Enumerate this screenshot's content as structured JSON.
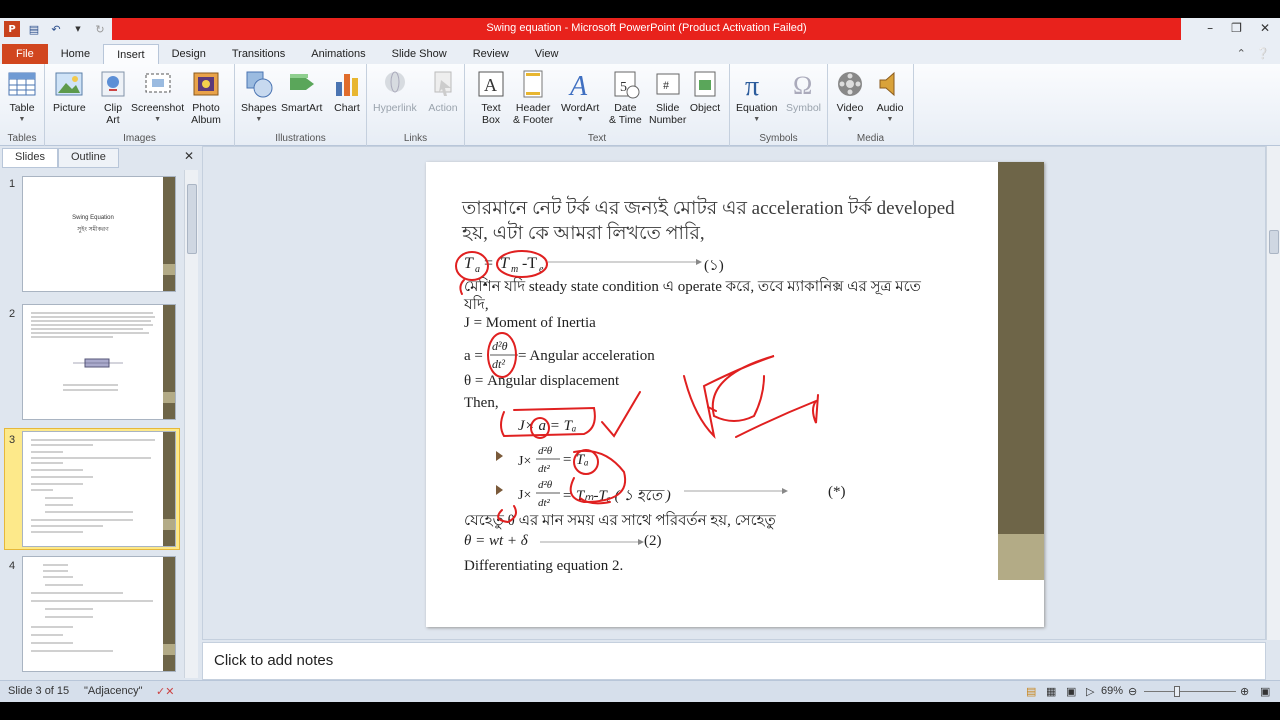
{
  "window": {
    "title": "Swing equation  -  Microsoft PowerPoint (Product Activation Failed)"
  },
  "ribbon_tabs": [
    "File",
    "Home",
    "Insert",
    "Design",
    "Transitions",
    "Animations",
    "Slide Show",
    "Review",
    "View"
  ],
  "active_tab": "Insert",
  "ribbon": {
    "tables": {
      "label": "Tables",
      "table": "Table"
    },
    "images": {
      "label": "Images",
      "picture": "Picture",
      "clipart": "Clip\nArt",
      "screenshot": "Screenshot",
      "photoalbum": "Photo\nAlbum"
    },
    "illustrations": {
      "label": "Illustrations",
      "shapes": "Shapes",
      "smartart": "SmartArt",
      "chart": "Chart"
    },
    "links": {
      "label": "Links",
      "hyperlink": "Hyperlink",
      "action": "Action"
    },
    "text": {
      "label": "Text",
      "textbox": "Text\nBox",
      "headerfooter": "Header\n& Footer",
      "wordart": "WordArt",
      "datetime": "Date\n& Time",
      "slidenumber": "Slide\nNumber",
      "object": "Object"
    },
    "symbols": {
      "label": "Symbols",
      "equation": "Equation",
      "symbol": "Symbol"
    },
    "media": {
      "label": "Media",
      "video": "Video",
      "audio": "Audio"
    }
  },
  "left_panel": {
    "tab_slides": "Slides",
    "tab_outline": "Outline",
    "slides": [
      {
        "number": "1",
        "title": "Swing Equation",
        "subtitle": "সুইং সমীকরণ"
      },
      {
        "number": "2"
      },
      {
        "number": "3"
      },
      {
        "number": "4"
      }
    ]
  },
  "slide": {
    "line1": "তারমানে নেট টর্ক এর জন্যই মোটর এর acceleration টর্ক developed",
    "line2": "হয়, এটা কে আমরা লিখতে পারি,",
    "eq1_mark": "(১)",
    "line3": "মেশিন যদি steady state condition এ operate করে, তবে ম্যাকানিক্স এর সূত্র মতে",
    "line4": "যদি,",
    "line5": "J = Moment of Inertia",
    "line6": "= Angular acceleration",
    "line6_prefix": "a =",
    "line7": "θ = Angular displacement",
    "line8": "Then,",
    "eq_a": "J× a = Tₐ",
    "eq_b_suffix": "= Tₐ",
    "eq_c_suffix": "= Tₘ-Tₑ ( ১ হতে )",
    "eq_c_mark": "(*)",
    "line9": "যেহেতু θ এর মান সময় এর সাথে পরিবর্তন হয়, সেহেতু",
    "line10": "θ = wt + δ",
    "eq2_mark": "(2)",
    "line11": "Differentiating  equation  2."
  },
  "notes": {
    "placeholder": "Click to add notes"
  },
  "status": {
    "slide_info": "Slide 3 of 15",
    "theme": "\"Adjacency\"",
    "zoom": "69%"
  }
}
